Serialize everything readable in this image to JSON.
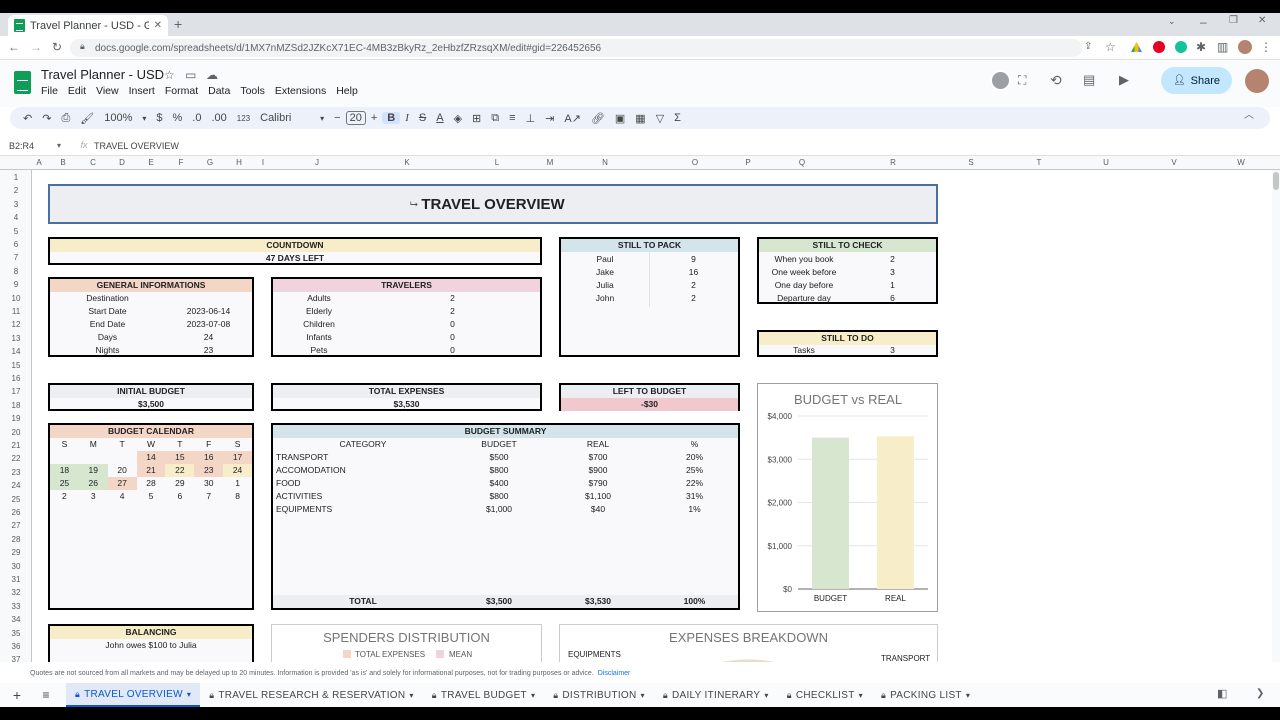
{
  "browser": {
    "tab_title": "Travel Planner - USD - Google Sh",
    "url": "docs.google.com/spreadsheets/d/1MX7nMZSd2JZKcX71EC-4MB3zBkyRz_2eHbzfZRzsqXM/edit#gid=226452656"
  },
  "app": {
    "doc_title": "Travel Planner - USD",
    "menus": [
      "File",
      "Edit",
      "View",
      "Insert",
      "Format",
      "Data",
      "Tools",
      "Extensions",
      "Help"
    ],
    "share_label": "Share"
  },
  "toolbar": {
    "zoom": "100%",
    "currency": "$",
    "percent": "%",
    "dec_minus": ".0",
    "dec_plus": ".00",
    "number_format": "123",
    "font": "Calibri",
    "font_size": "20"
  },
  "formula_bar": {
    "range": "B2:R4",
    "content": "TRAVEL OVERVIEW"
  },
  "columns": [
    "A",
    "B",
    "C",
    "D",
    "E",
    "F",
    "G",
    "H",
    "I",
    "J",
    "K",
    "L",
    "M",
    "N",
    "O",
    "P",
    "Q",
    "R",
    "S",
    "T",
    "U",
    "V",
    "W"
  ],
  "rows": [
    "1",
    "2",
    "3",
    "4",
    "5",
    "6",
    "7",
    "8",
    "9",
    "10",
    "11",
    "12",
    "13",
    "14",
    "15",
    "16",
    "17",
    "18",
    "19",
    "20",
    "21",
    "22",
    "23",
    "24",
    "25",
    "26",
    "27",
    "28",
    "29",
    "30",
    "31",
    "32",
    "33",
    "34",
    "35",
    "36",
    "37"
  ],
  "sheet": {
    "title": "TRAVEL OVERVIEW",
    "countdown": {
      "header": "COUNTDOWN",
      "value": "47 DAYS LEFT"
    },
    "still_to_pack": {
      "header": "STILL TO PACK",
      "items": [
        [
          "Paul",
          "9"
        ],
        [
          "Jake",
          "16"
        ],
        [
          "Julia",
          "2"
        ],
        [
          "John",
          "2"
        ]
      ]
    },
    "still_to_check": {
      "header": "STILL TO CHECK",
      "items": [
        [
          "When you book",
          "2"
        ],
        [
          "One week before",
          "3"
        ],
        [
          "One day before",
          "1"
        ],
        [
          "Departure day",
          "6"
        ]
      ]
    },
    "general": {
      "header": "GENERAL INFORMATIONS",
      "items": [
        [
          "Destination",
          ""
        ],
        [
          "Start Date",
          "2023-06-14"
        ],
        [
          "End Date",
          "2023-07-08"
        ],
        [
          "Days",
          "24"
        ],
        [
          "Nights",
          "23"
        ]
      ]
    },
    "travelers": {
      "header": "TRAVELERS",
      "items": [
        [
          "Adults",
          "2"
        ],
        [
          "Elderly",
          "2"
        ],
        [
          "Children",
          "0"
        ],
        [
          "Infants",
          "0"
        ],
        [
          "Pets",
          "0"
        ]
      ]
    },
    "still_to_do": {
      "header": "STILL TO DO",
      "label": "Tasks",
      "value": "3"
    },
    "initial_budget": {
      "header": "INITIAL BUDGET",
      "value": "$3,500"
    },
    "total_expenses": {
      "header": "TOTAL EXPENSES",
      "value": "$3,530"
    },
    "left_to_budget": {
      "header": "LEFT TO BUDGET",
      "value": "-$30"
    },
    "calendar": {
      "header": "BUDGET CALENDAR",
      "days": [
        "S",
        "M",
        "T",
        "W",
        "T",
        "F",
        "S"
      ],
      "weeks": [
        [
          "",
          "",
          "",
          "14",
          "15",
          "16",
          "17"
        ],
        [
          "18",
          "19",
          "20",
          "21",
          "22",
          "23",
          "24"
        ],
        [
          "25",
          "26",
          "27",
          "28",
          "29",
          "30",
          "1"
        ],
        [
          "2",
          "3",
          "4",
          "5",
          "6",
          "7",
          "8"
        ]
      ]
    },
    "budget_summary": {
      "header": "BUDGET SUMMARY",
      "columns": [
        "CATEGORY",
        "BUDGET",
        "REAL",
        "%"
      ],
      "rows": [
        [
          "TRANSPORT",
          "$500",
          "$700",
          "20%"
        ],
        [
          "ACCOMODATION",
          "$800",
          "$900",
          "25%"
        ],
        [
          "FOOD",
          "$400",
          "$790",
          "22%"
        ],
        [
          "ACTIVITIES",
          "$800",
          "$1,100",
          "31%"
        ],
        [
          "EQUIPMENTS",
          "$1,000",
          "$40",
          "1%"
        ]
      ],
      "total": [
        "TOTAL",
        "$3,500",
        "$3,530",
        "100%"
      ]
    },
    "balancing": {
      "header": "BALANCING",
      "text": "John owes $100 to Julia"
    },
    "spenders": {
      "title": "SPENDERS DISTRIBUTION",
      "legend": [
        "TOTAL EXPENSES",
        "MEAN"
      ]
    },
    "breakdown": {
      "title": "EXPENSES BREAKDOWN",
      "labels": [
        "EQUIPMENTS",
        "TRANSPORT"
      ]
    }
  },
  "chart_data": {
    "type": "bar",
    "title": "BUDGET vs REAL",
    "categories": [
      "BUDGET",
      "REAL"
    ],
    "values": [
      3500,
      3530
    ],
    "ylim": [
      0,
      4000
    ],
    "yticks": [
      "$0",
      "$1,000",
      "$2,000",
      "$3,000",
      "$4,000"
    ],
    "colors": [
      "#d6e6cf",
      "#f7edc8"
    ]
  },
  "disclaimer": "Quotes are not sourced from all markets and may be delayed up to 20 minutes. Information is provided 'as is' and solely for informational purposes, not for trading purposes or advice.",
  "disclaimer_link": "Disclaimer",
  "sheet_tabs": [
    "TRAVEL OVERVIEW",
    "TRAVEL RESEARCH & RESERVATION",
    "TRAVEL BUDGET",
    "DISTRIBUTION",
    "DAILY ITINERARY",
    "CHECKLIST",
    "PACKING LIST"
  ],
  "colors": {
    "accent": "#0b57d0",
    "orange_hdr": "#f4d6c6",
    "yellow_hdr": "#f7edc8",
    "blue_hdr": "#d3e4ea",
    "pink_hdr": "#f0d3dc",
    "green_hdr": "#d6e6cf"
  }
}
